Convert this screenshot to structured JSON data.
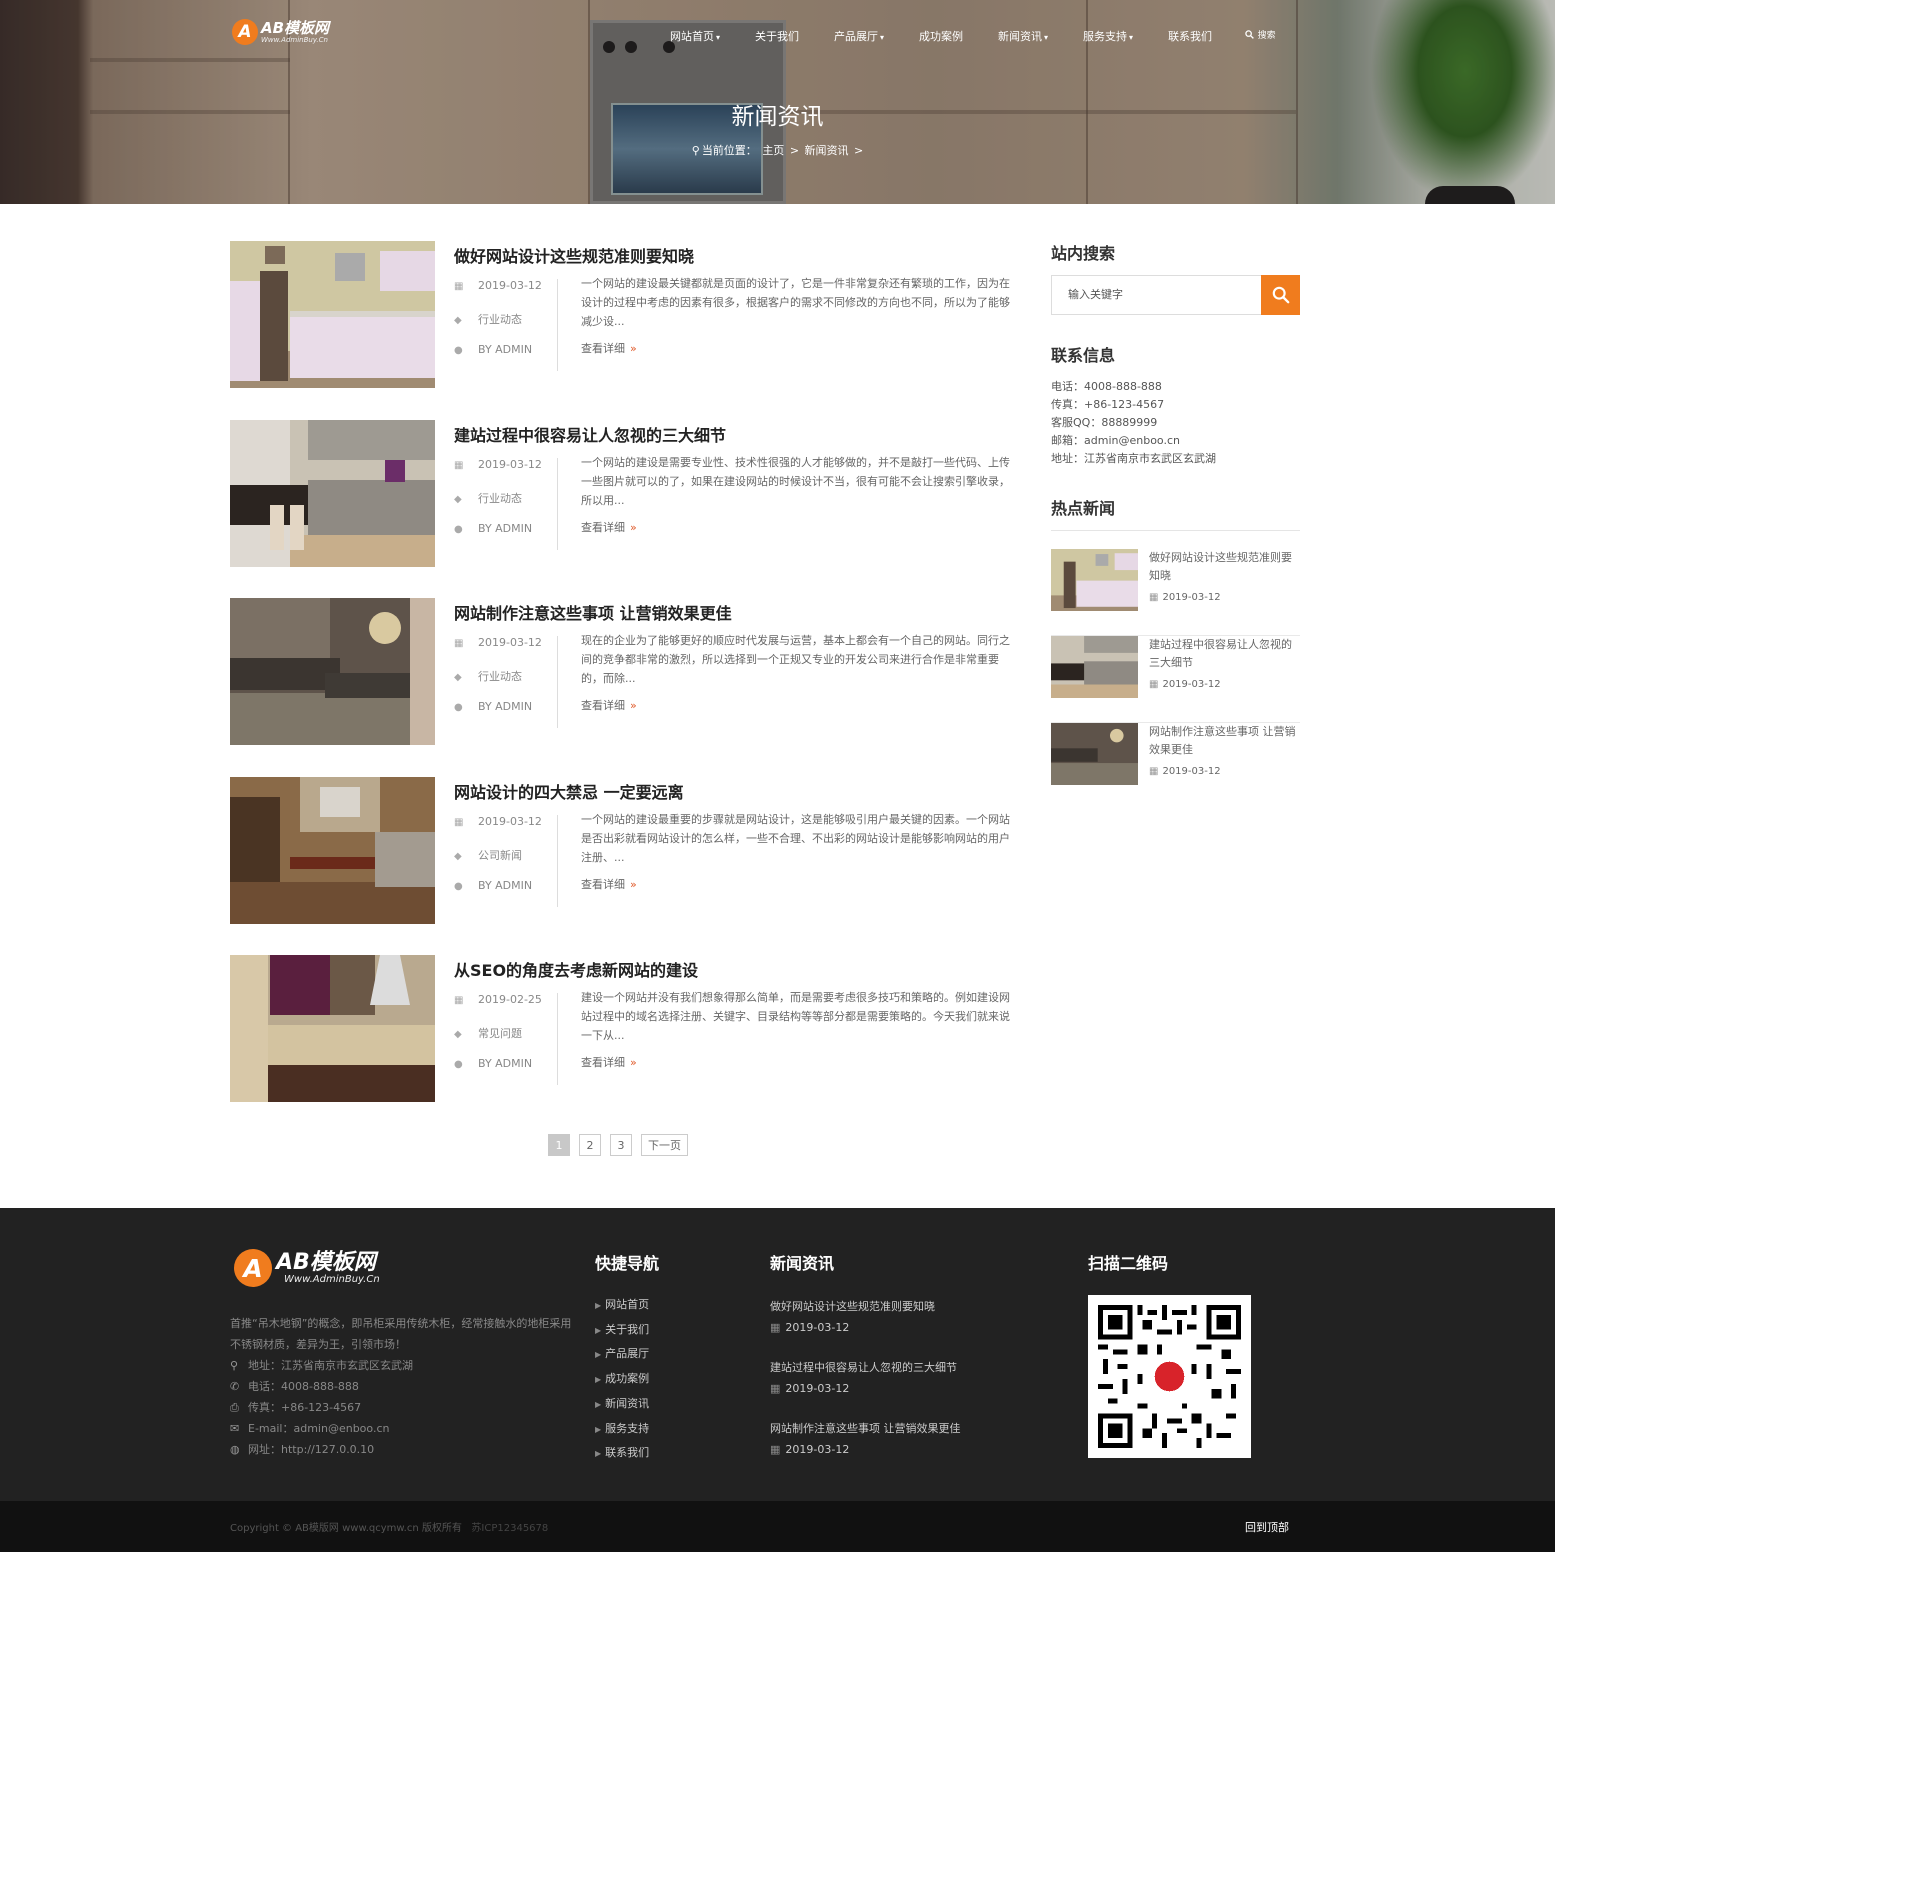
{
  "logo": {
    "mark": "A",
    "name": "AB模板网",
    "url": "Www.AdminBuy.Cn"
  },
  "nav": [
    {
      "label": "网站首页",
      "dropdown": true
    },
    {
      "label": "关于我们",
      "dropdown": false
    },
    {
      "label": "产品展厅",
      "dropdown": true
    },
    {
      "label": "成功案例",
      "dropdown": false
    },
    {
      "label": "新闻资讯",
      "dropdown": true
    },
    {
      "label": "服务支持",
      "dropdown": true
    },
    {
      "label": "联系我们",
      "dropdown": false
    }
  ],
  "nav_search_label": "搜索",
  "hero": {
    "title": "新闻资讯",
    "breadcrumb": {
      "prefix": "当前位置：",
      "home": "主页",
      "sep": ">",
      "current": "新闻资讯",
      "end": ">"
    }
  },
  "articles": [
    {
      "title": "做好网站设计这些规范准则要知晓",
      "date": "2019-03-12",
      "category": "行业动态",
      "author": "BY ADMIN",
      "excerpt": "一个网站的建设最关键都就是页面的设计了，它是一件非常复杂还有繁琐的工作，因为在设计的过程中考虑的因素有很多，根据客户的需求不同修改的方向也不同，所以为了能够减少设...",
      "more": "查看详细"
    },
    {
      "title": "建站过程中很容易让人忽视的三大细节",
      "date": "2019-03-12",
      "category": "行业动态",
      "author": "BY ADMIN",
      "excerpt": "一个网站的建设是需要专业性、技术性很强的人才能够做的，并不是敲打一些代码、上传一些图片就可以的了，如果在建设网站的时候设计不当，很有可能不会让搜索引擎收录，所以用...",
      "more": "查看详细"
    },
    {
      "title": "网站制作注意这些事项 让营销效果更佳",
      "date": "2019-03-12",
      "category": "行业动态",
      "author": "BY ADMIN",
      "excerpt": "现在的企业为了能够更好的顺应时代发展与运营，基本上都会有一个自己的网站。同行之间的竞争都非常的激烈，所以选择到一个正规又专业的开发公司来进行合作是非常重要的，而除...",
      "more": "查看详细"
    },
    {
      "title": "网站设计的四大禁忌 一定要远离",
      "date": "2019-03-12",
      "category": "公司新闻",
      "author": "BY ADMIN",
      "excerpt": "一个网站的建设最重要的步骤就是网站设计，这是能够吸引用户最关键的因素。一个网站是否出彩就看网站设计的怎么样，一些不合理、不出彩的网站设计是能够影响网站的用户注册、...",
      "more": "查看详细"
    },
    {
      "title": "从SEO的角度去考虑新网站的建设",
      "date": "2019-02-25",
      "category": "常见问题",
      "author": "BY ADMIN",
      "excerpt": "建设一个网站并没有我们想象得那么简单，而是需要考虑很多技巧和策略的。例如建设网站过程中的域名选择注册、关键字、目录结构等等部分都是需要策略的。今天我们就来说一下从...",
      "more": "查看详细"
    }
  ],
  "pagination": {
    "pages": [
      "1",
      "2",
      "3"
    ],
    "current": "1",
    "next": "下一页"
  },
  "sidebar": {
    "search_title": "站内搜索",
    "search_placeholder": "输入关键字",
    "contact_title": "联系信息",
    "contact": [
      "电话：4008-888-888",
      "传真：+86-123-4567",
      "客服QQ：88889999",
      "邮箱：admin@enboo.cn",
      "地址：江苏省南京市玄武区玄武湖"
    ],
    "hot_title": "热点新闻",
    "hot": [
      {
        "title": "做好网站设计这些规范准则要知晓",
        "date": "2019-03-12"
      },
      {
        "title": "建站过程中很容易让人忽视的三大细节",
        "date": "2019-03-12"
      },
      {
        "title": "网站制作注意这些事项 让营销效果更佳",
        "date": "2019-03-12"
      }
    ]
  },
  "footer": {
    "about": "首推“吊木地钢”的概念，即吊柜采用传统木柜，经常接触水的地柜采用不锈钢材质，差异为王，引领市场！",
    "address": "地址：江苏省南京市玄武区玄武湖",
    "phone": "电话：4008-888-888",
    "fax": "传真：+86-123-4567",
    "email": "E-mail：admin@enboo.cn",
    "website": "网址：http://127.0.0.10",
    "nav_title": "快捷导航",
    "nav": [
      "网站首页",
      "关于我们",
      "产品展厅",
      "成功案例",
      "新闻资讯",
      "服务支持",
      "联系我们"
    ],
    "news_title": "新闻资讯",
    "news": [
      {
        "title": "做好网站设计这些规范准则要知晓",
        "date": "2019-03-12"
      },
      {
        "title": "建站过程中很容易让人忽视的三大细节",
        "date": "2019-03-12"
      },
      {
        "title": "网站制作注意这些事项 让营销效果更佳",
        "date": "2019-03-12"
      }
    ],
    "qr_title": "扫描二维码",
    "copyright": "Copyright © AB模版网 www.qcymw.cn 版权所有",
    "icp": "苏ICP12345678",
    "back_to_top": "回到顶部"
  },
  "colors": {
    "accent": "#f07c1e",
    "footer_bg": "#222222",
    "bottom_bg": "#111111"
  }
}
